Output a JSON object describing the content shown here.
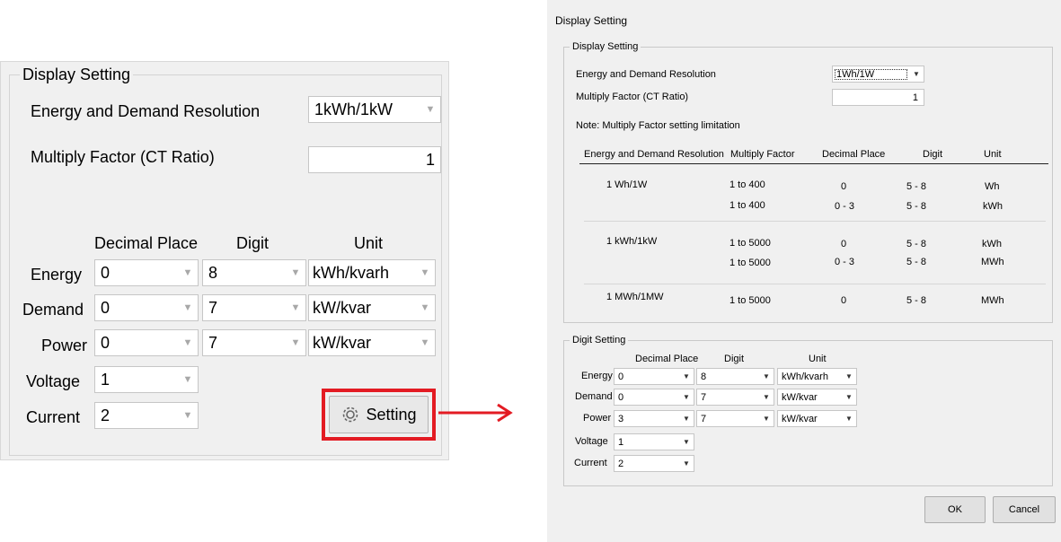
{
  "left_panel": {
    "group_title": "Display Setting",
    "resolution_label": "Energy and Demand Resolution",
    "resolution_value": "1kWh/1kW",
    "multiply_label": "Multiply Factor (CT Ratio)",
    "multiply_value": "1",
    "col_decimal": "Decimal Place",
    "col_digit": "Digit",
    "col_unit": "Unit",
    "rows": [
      {
        "label": "Energy",
        "decimal": "0",
        "digit": "8",
        "unit": "kWh/kvarh"
      },
      {
        "label": "Demand",
        "decimal": "0",
        "digit": "7",
        "unit": "kW/kvar"
      },
      {
        "label": "Power",
        "decimal": "0",
        "digit": "7",
        "unit": "kW/kvar"
      },
      {
        "label": "Voltage",
        "decimal": "1"
      },
      {
        "label": "Current",
        "decimal": "2"
      }
    ],
    "setting_button": "Setting",
    "highlight_color": "#e31b23"
  },
  "dialog": {
    "title": "Display Setting",
    "display_group_title": "Display Setting",
    "resolution_label": "Energy and Demand Resolution",
    "resolution_value": "1Wh/1W",
    "multiply_label": "Multiply Factor (CT Ratio)",
    "multiply_value": "1",
    "note": "Note: Multiply Factor setting limitation",
    "table_headers": {
      "resolution": "Energy and Demand Resolution",
      "multiply": "Multiply Factor",
      "decimal": "Decimal Place",
      "digit": "Digit",
      "unit": "Unit"
    },
    "table_rows": [
      {
        "resolution": "1 Wh/1W",
        "multiply": "1 to 400",
        "decimal": "0",
        "digit": "5 - 8",
        "unit": "Wh"
      },
      {
        "resolution": "",
        "multiply": "1 to 400",
        "decimal": "0 - 3",
        "digit": "5 - 8",
        "unit": "kWh"
      },
      {
        "resolution": "1 kWh/1kW",
        "multiply": "1 to 5000",
        "decimal": "0",
        "digit": "5 - 8",
        "unit": "kWh"
      },
      {
        "resolution": "",
        "multiply": "1 to 5000",
        "decimal": "0 - 3",
        "digit": "5 - 8",
        "unit": "MWh"
      },
      {
        "resolution": "1 MWh/1MW",
        "multiply": "1 to 5000",
        "decimal": "0",
        "digit": "5 - 8",
        "unit": "MWh"
      }
    ],
    "digit_group_title": "Digit Setting",
    "col_decimal": "Decimal Place",
    "col_digit": "Digit",
    "col_unit": "Unit",
    "digit_rows": [
      {
        "label": "Energy",
        "decimal": "0",
        "digit": "8",
        "unit": "kWh/kvarh"
      },
      {
        "label": "Demand",
        "decimal": "0",
        "digit": "7",
        "unit": "kW/kvar"
      },
      {
        "label": "Power",
        "decimal": "3",
        "digit": "7",
        "unit": "kW/kvar"
      },
      {
        "label": "Voltage",
        "decimal": "1"
      },
      {
        "label": "Current",
        "decimal": "2"
      }
    ],
    "ok_button": "OK",
    "cancel_button": "Cancel"
  }
}
